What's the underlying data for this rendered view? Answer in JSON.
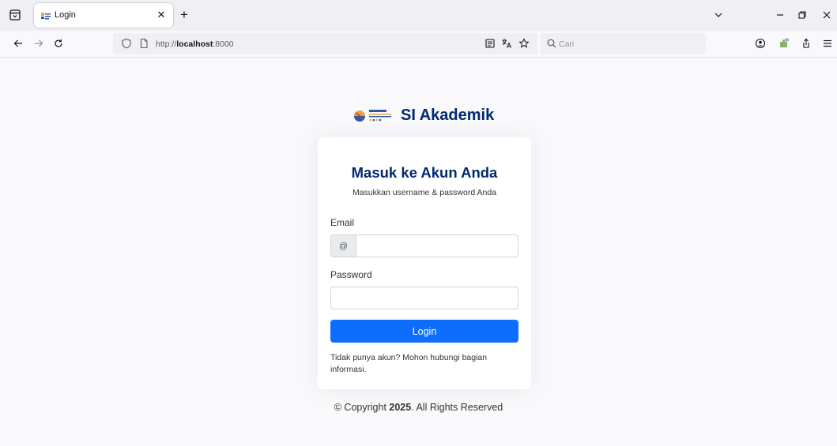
{
  "browser": {
    "tab": {
      "title": "Login"
    },
    "url": {
      "scheme": "http://",
      "host": "localhost",
      "port": ":8000"
    },
    "search": {
      "placeholder": "Cari"
    }
  },
  "page": {
    "brand": {
      "name": "SI Akademik"
    },
    "card": {
      "title": "Masuk ke Akun Anda",
      "subtitle": "Masukkan username & password Anda",
      "email_label": "Email",
      "email_prefix": "@",
      "email_value": "",
      "password_label": "Password",
      "password_value": "",
      "login_label": "Login",
      "help_text": "Tidak punya akun? Mohon hubungi bagian informasi."
    },
    "footer": {
      "prefix": "© Copyright",
      "year": "2025",
      "suffix": ". All Rights Reserved"
    }
  },
  "colors": {
    "brand_navy": "#012970",
    "primary_button": "#0d6efd",
    "page_background": "#f9f9fb"
  },
  "icons": [
    "tab-list-icon",
    "favicon-icon",
    "close-icon",
    "plus-icon",
    "chevron-down-icon",
    "minimize-icon",
    "restore-icon",
    "back-icon",
    "forward-icon",
    "reload-icon",
    "shield-icon",
    "page-icon",
    "reader-mode-icon",
    "translate-icon",
    "star-icon",
    "search-icon",
    "account-icon",
    "extension-icon",
    "share-icon",
    "menu-icon"
  ]
}
